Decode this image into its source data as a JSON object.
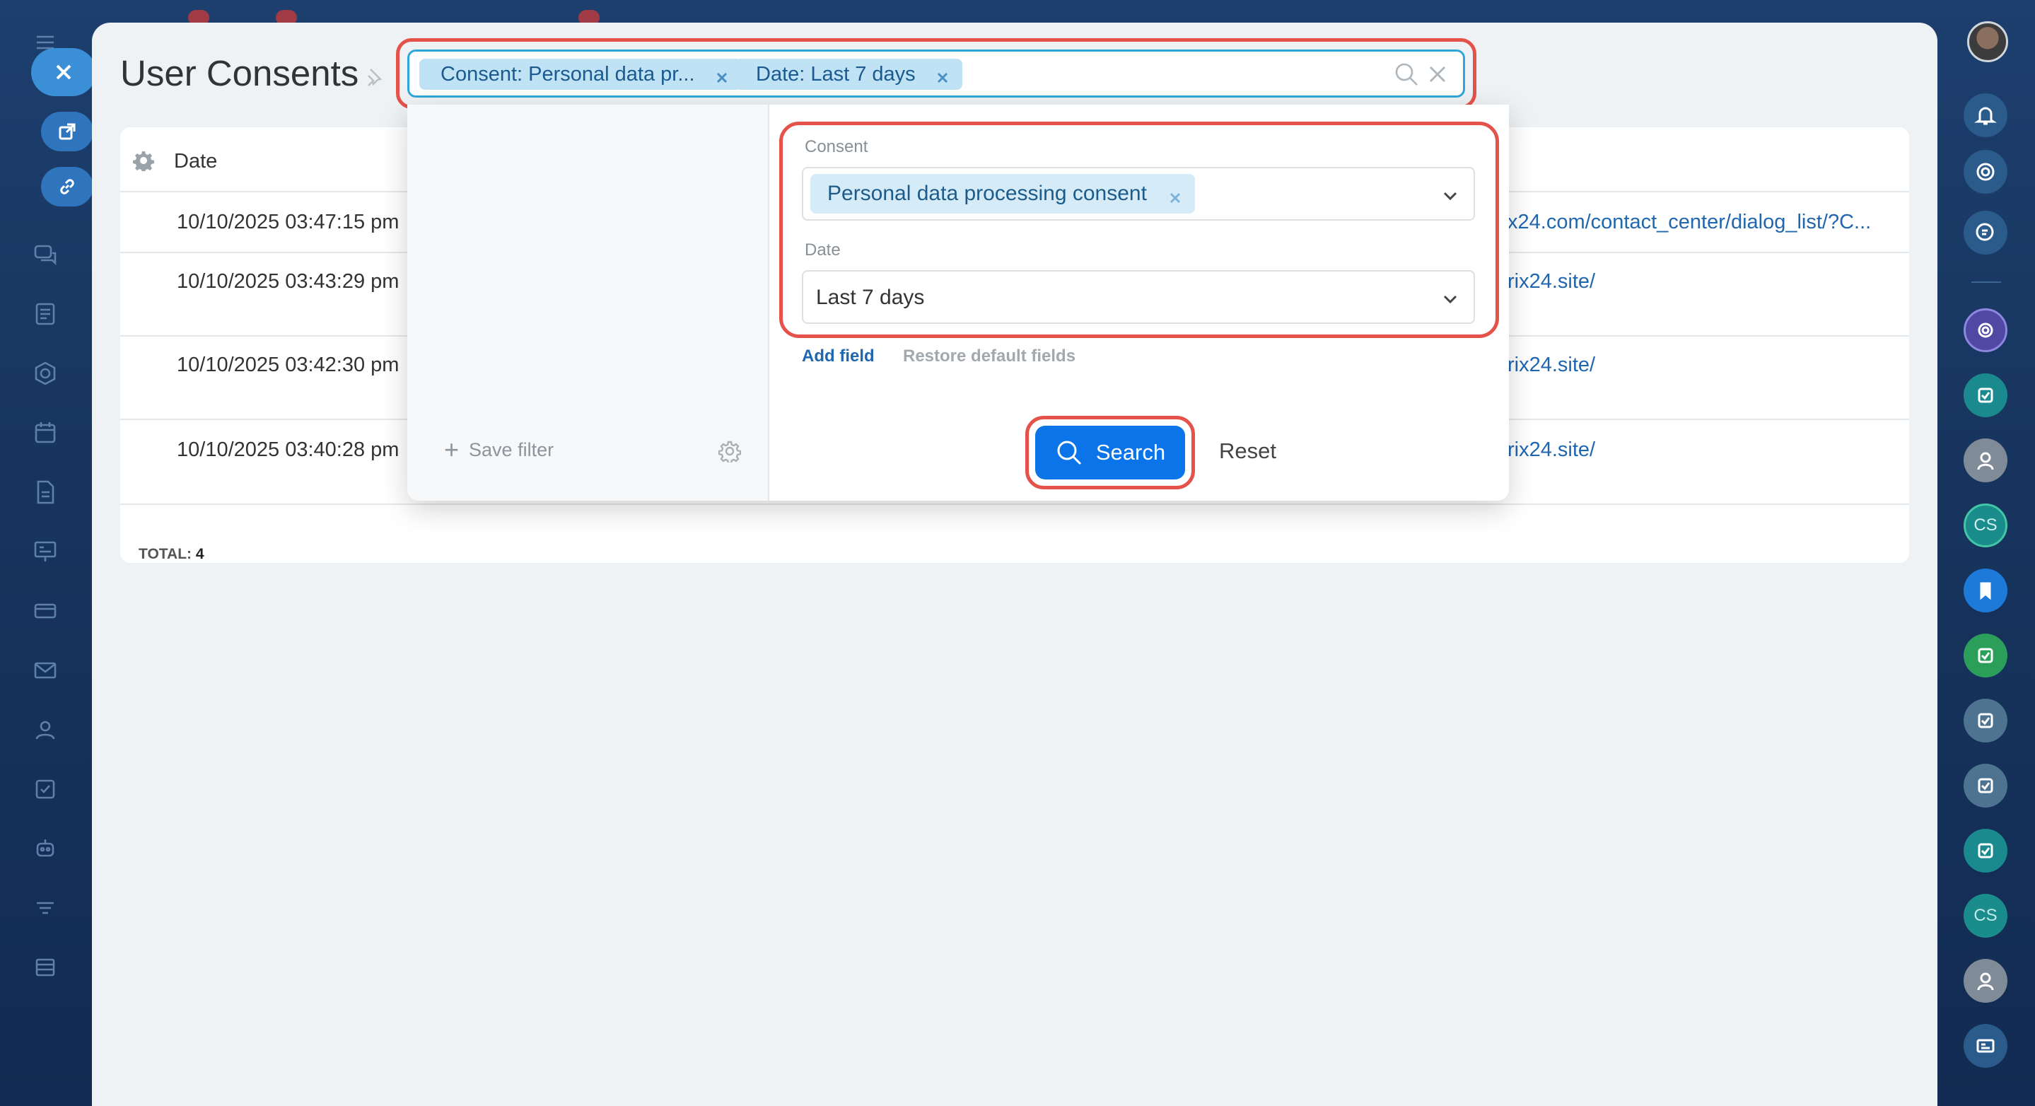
{
  "page": {
    "title": "User Consents"
  },
  "filter_bar": {
    "chips": [
      {
        "label": "Consent: Personal data pr..."
      },
      {
        "label": "Date: Last 7 days"
      }
    ]
  },
  "filter_popup": {
    "save_filter_label": "Save filter",
    "fields": {
      "consent": {
        "label": "Consent",
        "value": "Personal data processing consent"
      },
      "date": {
        "label": "Date",
        "value": "Last 7 days"
      }
    },
    "add_field_label": "Add field",
    "restore_label": "Restore default fields",
    "search_label": "Search",
    "reset_label": "Reset"
  },
  "grid": {
    "column_date": "Date",
    "rows": [
      {
        "date": "10/10/2025 03:47:15 pm",
        "link": "x24.com/contact_center/dialog_list/?C..."
      },
      {
        "date": "10/10/2025 03:43:29 pm",
        "link": "rix24.site/"
      },
      {
        "date": "10/10/2025 03:42:30 pm",
        "link": "rix24.site/"
      },
      {
        "date": "10/10/2025 03:40:28 pm",
        "link": "rix24.site/"
      }
    ],
    "total_label": "TOTAL:",
    "total_value": "4"
  },
  "right_rail": {
    "cs_label": "CS"
  },
  "colors": {
    "accent": "#0a74e8",
    "highlight": "#e5524a",
    "link": "#2067b0",
    "chip": "#bfe3f5"
  }
}
